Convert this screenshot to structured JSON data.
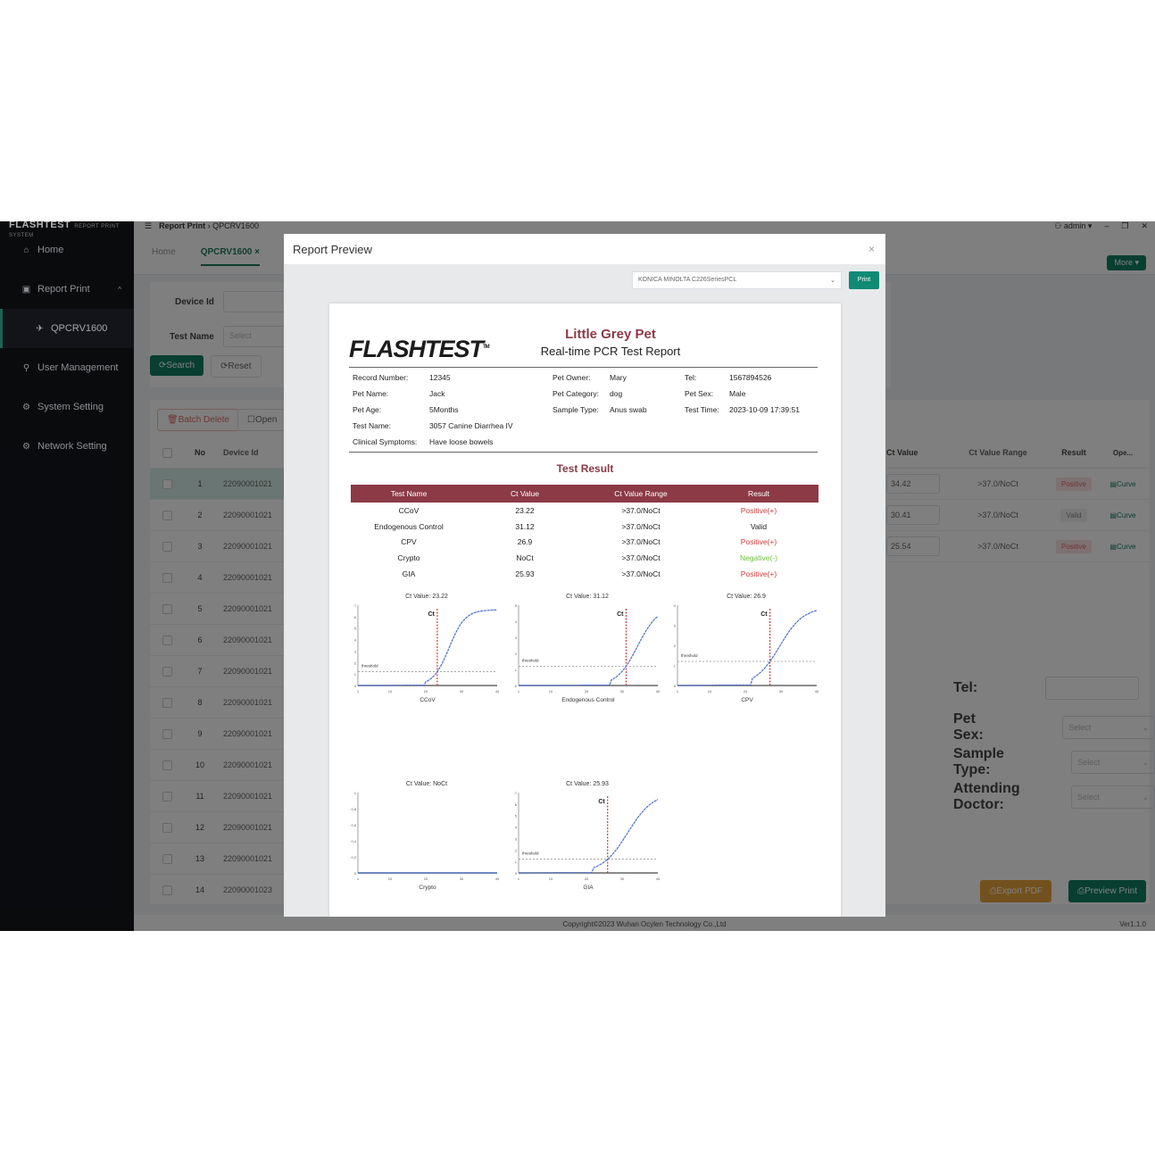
{
  "app": {
    "logo": "FLASHTEST",
    "logo_sub": "REPORT PRINT SYSTEM",
    "breadcrumb": [
      "Report Print",
      "QPCRV1600"
    ],
    "user": "admin",
    "window_controls": [
      "minimize",
      "restore",
      "close"
    ]
  },
  "sidebar": {
    "items": [
      {
        "label": "Home",
        "icon": "home-icon"
      },
      {
        "label": "Report Print",
        "icon": "report-icon"
      },
      {
        "label": "QPCRV1600",
        "icon": "pin-icon"
      },
      {
        "label": "User Management",
        "icon": "user-icon"
      },
      {
        "label": "System Setting",
        "icon": "gear-icon"
      },
      {
        "label": "Network Setting",
        "icon": "network-icon"
      }
    ]
  },
  "tabs": [
    {
      "label": "Home"
    },
    {
      "label": "QPCRV1600 ×"
    }
  ],
  "more_button": "More ▾",
  "search": {
    "device_id_label": "Device Id",
    "device_id_value": "",
    "test_name_label": "Test Name",
    "test_name_placeholder": "Select",
    "search_button": "Search",
    "reset_button": "Reset"
  },
  "table": {
    "batch_delete": "Batch Delete",
    "open_button": "Open",
    "columns": [
      "No",
      "Device Id"
    ],
    "rows": [
      {
        "no": "1",
        "device_id": "22090001021"
      },
      {
        "no": "2",
        "device_id": "22090001021"
      },
      {
        "no": "3",
        "device_id": "22090001021"
      },
      {
        "no": "4",
        "device_id": "22090001021"
      },
      {
        "no": "5",
        "device_id": "22090001021"
      },
      {
        "no": "6",
        "device_id": "22090001021"
      },
      {
        "no": "7",
        "device_id": "22090001021"
      },
      {
        "no": "8",
        "device_id": "22090001021"
      },
      {
        "no": "9",
        "device_id": "22090001021"
      },
      {
        "no": "10",
        "device_id": "22090001021"
      },
      {
        "no": "11",
        "device_id": "22090001021"
      },
      {
        "no": "12",
        "device_id": "22090001021"
      },
      {
        "no": "13",
        "device_id": "22090001021"
      },
      {
        "no": "14",
        "device_id": "22090001023"
      }
    ],
    "right_columns": [
      "Ct Value",
      "Ct Value Range",
      "Result",
      "Ope..."
    ],
    "right_rows": [
      {
        "ct": "34.42",
        "range": ">37.0/NoCt",
        "result": "Positive",
        "op": "Curve"
      },
      {
        "ct": "30.41",
        "range": ">37.0/NoCt",
        "result": "Valid",
        "op": "Curve"
      },
      {
        "ct": "25.54",
        "range": ">37.0/NoCt",
        "result": "Positive",
        "op": "Curve"
      }
    ]
  },
  "form": {
    "tel_label": "Tel:",
    "pet_sex_label": "Pet Sex:",
    "sample_type_label": "Sample Type:",
    "attending_doctor_label": "Attending Doctor:",
    "select_placeholder": "Select"
  },
  "actions": {
    "export_pdf": "Export PDF",
    "preview_print": "Preview Print"
  },
  "footer": {
    "copyright": "Copyright©2023 Wuhan Ocylen Technology Co.,Ltd",
    "version": "Ver1.1.0"
  },
  "modal": {
    "title": "Report Preview",
    "close": "×",
    "printer": "KONICA MINOLTA C226SeriesPCL",
    "print_button": "Print"
  },
  "report": {
    "brand": "FLASHTEST",
    "org": "Little Grey Pet",
    "title": "Real-time PCR Test Report",
    "info": {
      "record_number_label": "Record Number:",
      "record_number": "12345",
      "pet_name_label": "Pet Name:",
      "pet_name": "Jack",
      "pet_age_label": "Pet Age:",
      "pet_age": "5Months",
      "test_name_label": "Test Name:",
      "test_name": "3057 Canine Diarrhea IV",
      "clinical_label": "Clinical Symptoms:",
      "clinical": "Have loose bowels",
      "owner_label": "Pet Owner:",
      "owner": "Mary",
      "category_label": "Pet Category:",
      "category": "dog",
      "sample_label": "Sample Type:",
      "sample": "Anus swab",
      "tel_label": "Tel:",
      "tel": "1567894526",
      "sex_label": "Pet Sex:",
      "sex": "Male",
      "time_label": "Test Time:",
      "time": "2023-10-09 17:39:51"
    },
    "result_title": "Test Result",
    "columns": [
      "Test Name",
      "Ct Value",
      "Ct Value Range",
      "Result"
    ],
    "rows": [
      {
        "name": "CCoV",
        "ct": "23.22",
        "range": ">37.0/NoCt",
        "result": "Positive(+)",
        "status": "positive"
      },
      {
        "name": "Endogenous Control",
        "ct": "31.12",
        "range": ">37.0/NoCt",
        "result": "Valid",
        "status": "valid"
      },
      {
        "name": "CPV",
        "ct": "26.9",
        "range": ">37.0/NoCt",
        "result": "Positive(+)",
        "status": "positive"
      },
      {
        "name": "Crypto",
        "ct": "NoCt",
        "range": ">37.0/NoCt",
        "result": "Negative(-)",
        "status": "negative"
      },
      {
        "name": "GIA",
        "ct": "25.93",
        "range": ">37.0/NoCt",
        "result": "Positive(+)",
        "status": "positive"
      }
    ],
    "colors": {
      "brand": "#8b3a46",
      "positive": "#d43a3a",
      "negative": "#6bbf3c",
      "curve": "#4a6fc9",
      "ct_line": "#e03030"
    }
  },
  "chart_data": [
    {
      "type": "line",
      "title": "Ct Value: 23.22",
      "xlabel": "CCoV",
      "xlim": [
        1,
        40
      ],
      "ylim": [
        0,
        7
      ],
      "xticks": [
        1,
        10,
        20,
        30,
        40
      ],
      "yticks": [
        0,
        1,
        2,
        3,
        4,
        5,
        6,
        7
      ],
      "ct": 23.22,
      "threshold": 1.2,
      "threshold_label": "threshold",
      "ct_label": "Ct",
      "plateau": 6.6,
      "onset": 20,
      "slope": 0.45
    },
    {
      "type": "line",
      "title": "Ct Value: 31.12",
      "xlabel": "Endogenous Control",
      "xlim": [
        1,
        40
      ],
      "ylim": [
        0,
        5
      ],
      "xticks": [
        1,
        10,
        20,
        30,
        40
      ],
      "yticks": [
        0,
        1,
        2,
        3,
        4,
        5
      ],
      "ct": 31.12,
      "threshold": 1.2,
      "threshold_label": "threshold",
      "ct_label": "Ct",
      "plateau": 4.9,
      "onset": 27,
      "slope": 0.35
    },
    {
      "type": "line",
      "title": "Ct Value: 26.9",
      "xlabel": "CPV",
      "xlim": [
        1,
        40
      ],
      "ylim": [
        0,
        4
      ],
      "xticks": [
        1,
        10,
        20,
        30,
        40
      ],
      "yticks": [
        0,
        1,
        2,
        3,
        4
      ],
      "ct": 26.9,
      "threshold": 1.2,
      "threshold_label": "threshold",
      "ct_label": "Ct",
      "plateau": 3.9,
      "onset": 22,
      "slope": 0.3
    },
    {
      "type": "line",
      "title": "Ct Value: NoCt",
      "xlabel": "Crypto",
      "xlim": [
        1,
        40
      ],
      "ylim": [
        0,
        1
      ],
      "xticks": [
        1,
        10,
        20,
        30,
        40
      ],
      "yticks": [
        0,
        0.2,
        0.4,
        0.6,
        0.8,
        1
      ],
      "ct": null,
      "threshold": null,
      "plateau": 0
    },
    {
      "type": "line",
      "title": "Ct Value: 25.93",
      "xlabel": "GIA",
      "xlim": [
        1,
        40
      ],
      "ylim": [
        0,
        7
      ],
      "xticks": [
        1,
        10,
        20,
        30,
        40
      ],
      "yticks": [
        0,
        1,
        2,
        3,
        4,
        5,
        6,
        7
      ],
      "ct": 25.93,
      "threshold": 1.2,
      "threshold_label": "threshold",
      "ct_label": "Ct",
      "plateau": 7.0,
      "onset": 22,
      "slope": 0.28
    }
  ]
}
